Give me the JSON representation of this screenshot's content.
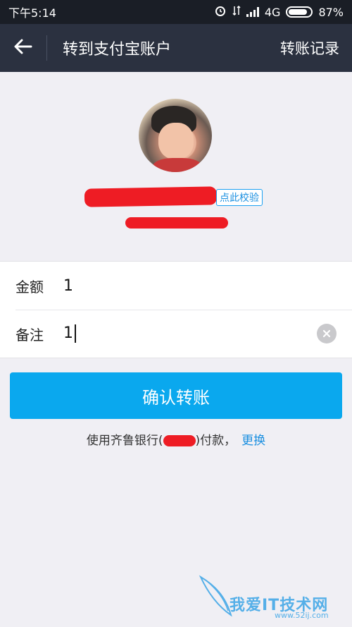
{
  "status_bar": {
    "time": "下午5:14",
    "network": "4G",
    "battery": "87%"
  },
  "nav": {
    "title": "转到支付宝账户",
    "right_link": "转账记录"
  },
  "recipient": {
    "verify_link": "点此校验"
  },
  "form": {
    "amount_label": "金额",
    "amount_value": "1",
    "note_label": "备注",
    "note_value": "1"
  },
  "actions": {
    "confirm_label": "确认转账",
    "payment_prefix": "使用齐鲁银行(",
    "payment_suffix": ")付款，",
    "change_label": "更换"
  },
  "watermark": {
    "text": "我爱IT技术网",
    "url": "www.52ij.com"
  },
  "colors": {
    "primary_button": "#0aa8ee",
    "nav_bar": "#2b3140",
    "link": "#1a8fe0"
  }
}
